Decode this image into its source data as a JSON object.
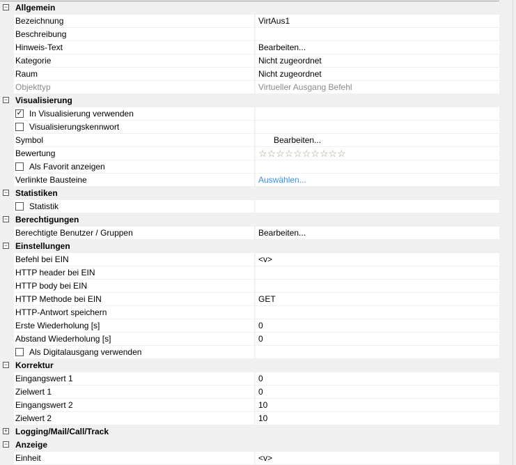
{
  "sections": [
    {
      "title": "Allgemein",
      "expanded": true,
      "rows": [
        {
          "name": "Bezeichnung",
          "value": "VirtAus1"
        },
        {
          "name": "Beschreibung",
          "value": ""
        },
        {
          "name": "Hinweis-Text",
          "value": "Bearbeiten..."
        },
        {
          "name": "Kategorie",
          "value": "Nicht zugeordnet"
        },
        {
          "name": "Raum",
          "value": "Nicht zugeordnet"
        },
        {
          "name": "Objekttyp",
          "value": "Virtueller Ausgang Befehl",
          "disabled": true
        }
      ]
    },
    {
      "title": "Visualisierung",
      "expanded": true,
      "rows": [
        {
          "name": "In Visualisierung verwenden",
          "checkbox": true,
          "checked": true
        },
        {
          "name": "Visualisierungskennwort",
          "checkbox": true,
          "checked": false
        },
        {
          "name": "Symbol",
          "value": "Bearbeiten...",
          "indent": true
        },
        {
          "name": "Bewertung",
          "rating": 0,
          "rating_max": 10
        },
        {
          "name": "Als Favorit anzeigen",
          "checkbox": true,
          "checked": false
        },
        {
          "name": "Verlinkte Bausteine",
          "value": "Auswählen...",
          "link": true
        }
      ]
    },
    {
      "title": "Statistiken",
      "expanded": true,
      "rows": [
        {
          "name": "Statistik",
          "checkbox": true,
          "checked": false
        }
      ]
    },
    {
      "title": "Berechtigungen",
      "expanded": true,
      "rows": [
        {
          "name": "Berechtigte Benutzer / Gruppen",
          "value": "Bearbeiten..."
        }
      ]
    },
    {
      "title": "Einstellungen",
      "expanded": true,
      "rows": [
        {
          "name": "Befehl bei EIN",
          "value": "<v>"
        },
        {
          "name": "HTTP header bei EIN",
          "value": ""
        },
        {
          "name": "HTTP body bei EIN",
          "value": ""
        },
        {
          "name": "HTTP Methode bei EIN",
          "value": "GET"
        },
        {
          "name": "HTTP-Antwort speichern",
          "value": ""
        },
        {
          "name": "Erste Wiederholung [s]",
          "value": "0"
        },
        {
          "name": "Abstand Wiederholung [s]",
          "value": "0"
        },
        {
          "name": "Als Digitalausgang verwenden",
          "checkbox": true,
          "checked": false
        }
      ]
    },
    {
      "title": "Korrektur",
      "expanded": true,
      "rows": [
        {
          "name": "Eingangswert 1",
          "value": "0"
        },
        {
          "name": "Zielwert 1",
          "value": "0"
        },
        {
          "name": "Eingangswert 2",
          "value": "10"
        },
        {
          "name": "Zielwert 2",
          "value": "10"
        }
      ]
    },
    {
      "title": "Logging/Mail/Call/Track",
      "expanded": false,
      "rows": []
    },
    {
      "title": "Anzeige",
      "expanded": true,
      "rows": [
        {
          "name": "Einheit",
          "value": "<v>"
        }
      ]
    }
  ],
  "icons": {
    "expanded": "minus-box-icon",
    "collapsed": "plus-box-icon",
    "star": "star-icon",
    "check": "checkmark-icon"
  }
}
